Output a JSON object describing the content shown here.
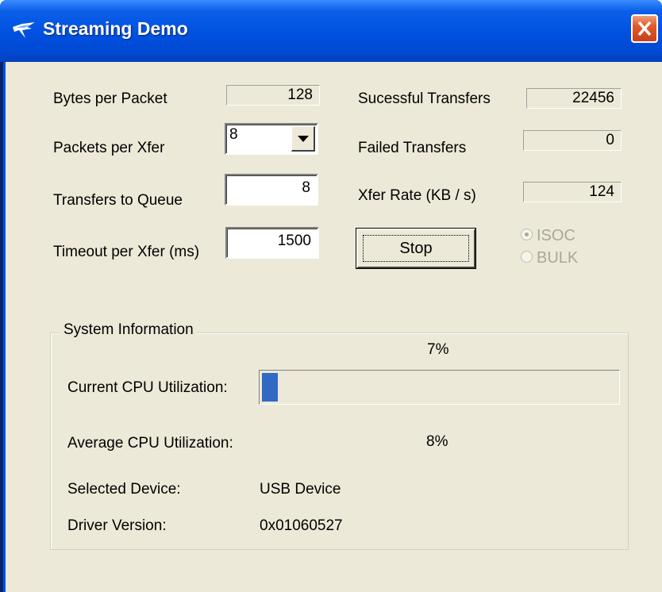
{
  "window": {
    "title": "Streaming Demo",
    "close_icon": "close-icon"
  },
  "settings": {
    "bytes_per_packet": {
      "label": "Bytes per Packet",
      "value": "128"
    },
    "packets_per_xfer": {
      "label": "Packets per Xfer",
      "value": "8"
    },
    "transfers_to_queue": {
      "label": "Transfers to Queue",
      "value": "8"
    },
    "timeout_per_xfer": {
      "label": "Timeout per Xfer (ms)",
      "value": "1500"
    }
  },
  "stats": {
    "successful": {
      "label": "Sucessful Transfers",
      "value": "22456"
    },
    "failed": {
      "label": "Failed Transfers",
      "value": "0"
    },
    "rate": {
      "label": "Xfer Rate (KB / s)",
      "value": "124"
    }
  },
  "controls": {
    "stop_label": "Stop",
    "radio_isoc": "ISOC",
    "radio_bulk": "BULK",
    "selected_mode": "ISOC"
  },
  "system_info": {
    "title": "System Information",
    "current_cpu_label": "Current CPU Utilization:",
    "current_cpu_value": "7%",
    "current_cpu_fraction": 0.07,
    "average_cpu_label": "Average CPU Utilization:",
    "average_cpu_value": "8%",
    "selected_device_label": "Selected Device:",
    "selected_device_value": "USB Device",
    "driver_version_label": "Driver Version:",
    "driver_version_value": "0x01060527"
  },
  "colors": {
    "titlebar": "#0054e3",
    "progress": "#316ac5",
    "face": "#ece9d8"
  }
}
